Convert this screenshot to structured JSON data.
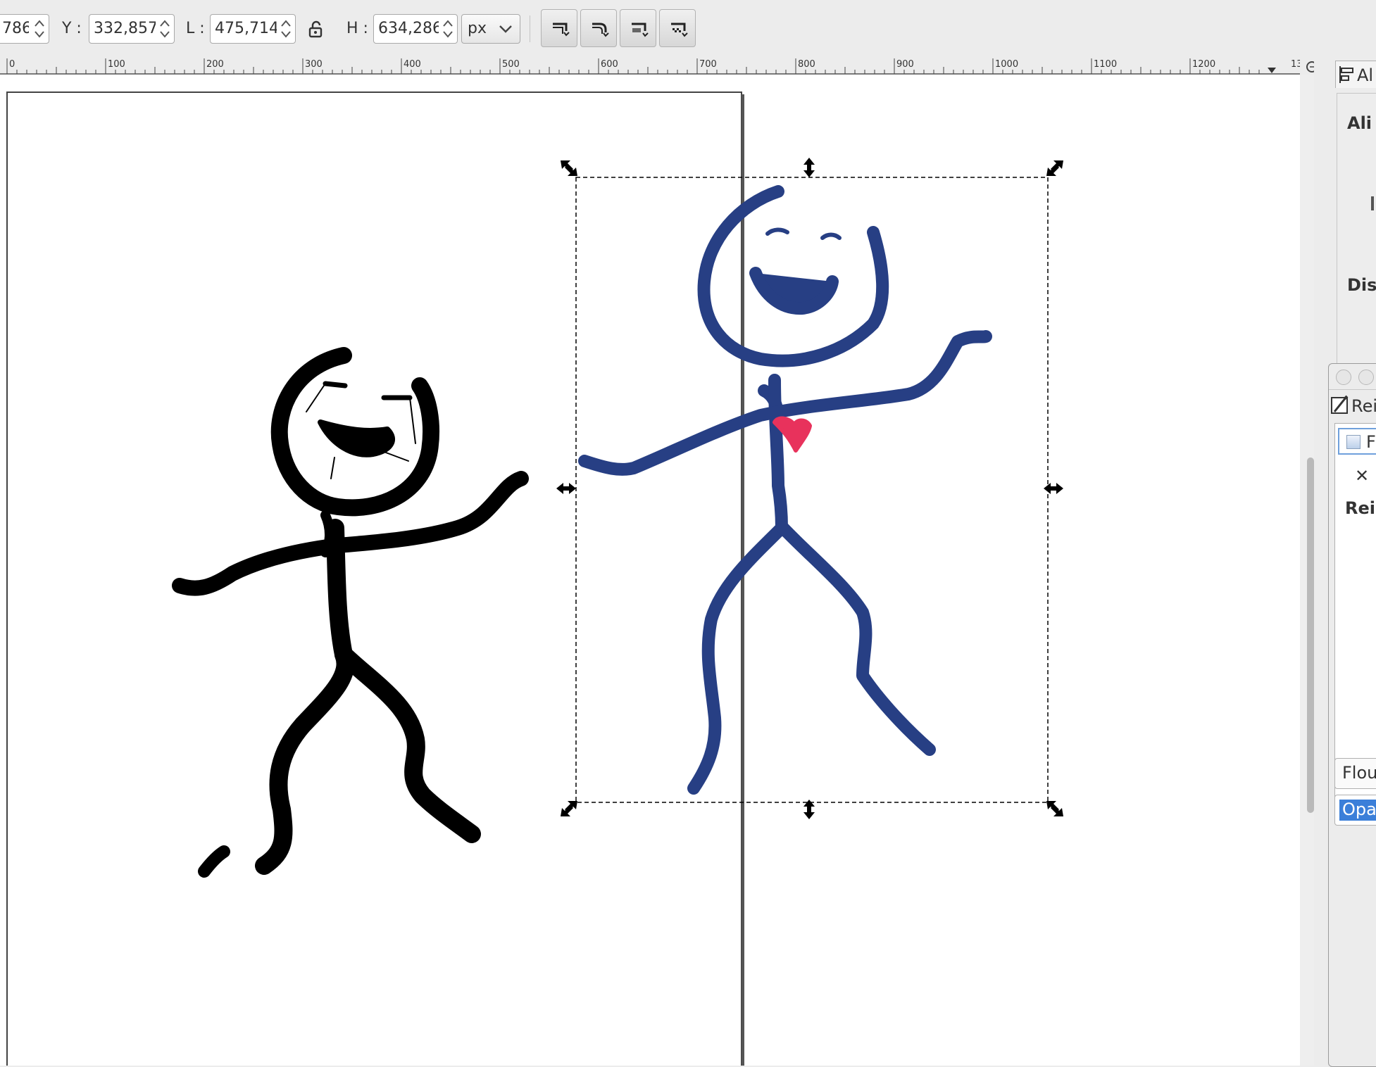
{
  "toolbar": {
    "x_value": "786",
    "y_label": "Y :",
    "y_value": "332,857",
    "w_label": "L :",
    "w_value": "475,714",
    "h_label": "H :",
    "h_value": "634,286",
    "unit": "px",
    "lock_icon": "lock-icon",
    "buttons": [
      "scale-stroke-icon",
      "scale-corners-icon",
      "move-gradients-icon",
      "move-patterns-icon"
    ]
  },
  "ruler": {
    "labels": [
      "0",
      "100",
      "200",
      "300",
      "400",
      "500",
      "600",
      "700",
      "800",
      "900",
      "1000",
      "1100",
      "1200",
      "13"
    ]
  },
  "dock": {
    "tab_label": "Al",
    "align_heading": "Ali",
    "distribute_heading": "Dis",
    "panel_tab_label": "Rei",
    "item_label": "F",
    "close_glyph": "✕",
    "section_label": "Rei",
    "blur_label": "Flou",
    "opacity_label": "Opa"
  },
  "colors": {
    "ink": "#000000",
    "blue_figure": "#273f84",
    "heart": "#e8325c",
    "highlight": "#3b7fd9"
  }
}
